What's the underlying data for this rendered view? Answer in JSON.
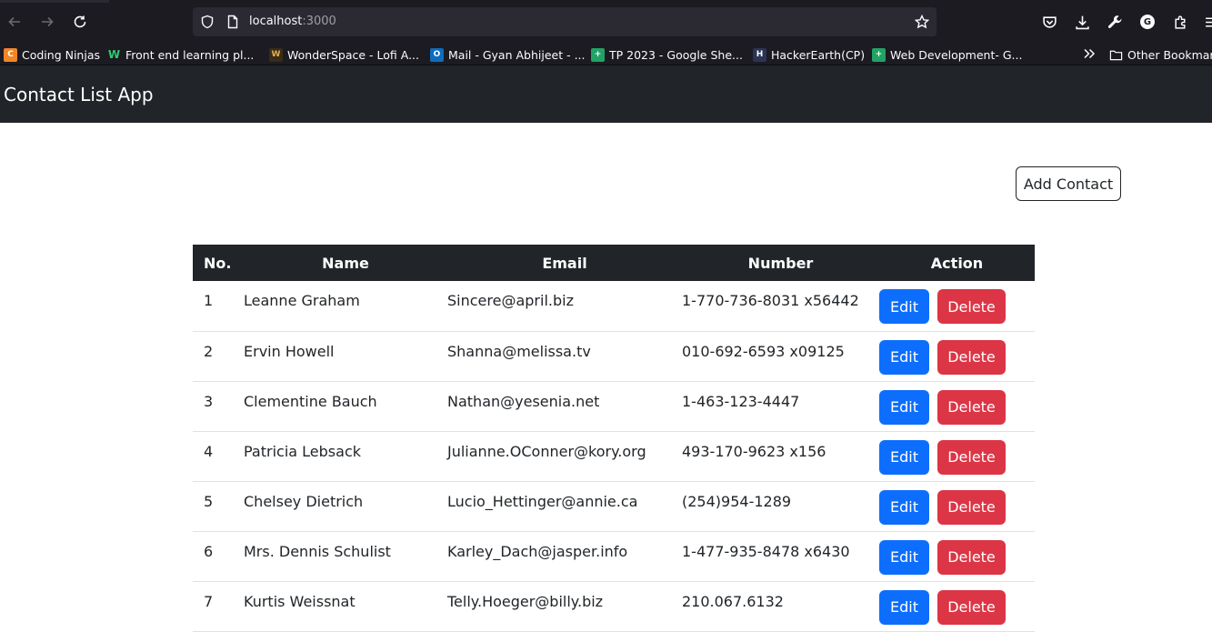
{
  "browser": {
    "url_host": "localhost",
    "url_port": ":3000",
    "profile_initial": "G",
    "bookmarks": [
      {
        "label": "Coding Ninjas",
        "fav_color": "#f28627",
        "fav_text": "C"
      },
      {
        "label": "Front end learning pl...",
        "fav_color": "#1c1b22",
        "fav_text": "W"
      },
      {
        "label": "WonderSpace - Lofi A...",
        "fav_color": "#3a2b1a",
        "fav_text": "W"
      },
      {
        "label": "Mail - Gyan Abhijeet - ...",
        "fav_color": "#0f6cbd",
        "fav_text": "O"
      },
      {
        "label": "TP 2023 - Google She...",
        "fav_color": "#21a366",
        "fav_text": "+"
      },
      {
        "label": "HackerEarth(CP)",
        "fav_color": "#2c3454",
        "fav_text": "H"
      },
      {
        "label": "Web Development- G...",
        "fav_color": "#21a366",
        "fav_text": "+"
      }
    ],
    "other_bookmarks": "Other Bookmarks"
  },
  "app": {
    "brand": "Contact List App",
    "add_button": "Add Contact",
    "table": {
      "headers": [
        "No.",
        "Name",
        "Email",
        "Number",
        "Action"
      ],
      "edit_label": "Edit",
      "delete_label": "Delete",
      "rows": [
        {
          "no": "1",
          "name": "Leanne Graham",
          "email": "Sincere@april.biz",
          "number": "1-770-736-8031 x56442"
        },
        {
          "no": "2",
          "name": "Ervin Howell",
          "email": "Shanna@melissa.tv",
          "number": "010-692-6593 x09125"
        },
        {
          "no": "3",
          "name": "Clementine Bauch",
          "email": "Nathan@yesenia.net",
          "number": "1-463-123-4447"
        },
        {
          "no": "4",
          "name": "Patricia Lebsack",
          "email": "Julianne.OConner@kory.org",
          "number": "493-170-9623 x156"
        },
        {
          "no": "5",
          "name": "Chelsey Dietrich",
          "email": "Lucio_Hettinger@annie.ca",
          "number": "(254)954-1289"
        },
        {
          "no": "6",
          "name": "Mrs. Dennis Schulist",
          "email": "Karley_Dach@jasper.info",
          "number": "1-477-935-8478 x6430"
        },
        {
          "no": "7",
          "name": "Kurtis Weissnat",
          "email": "Telly.Hoeger@billy.biz",
          "number": "210.067.6132"
        }
      ]
    }
  },
  "colors": {
    "navbar": "#212529",
    "edit": "#0d6efd",
    "delete": "#dc3545"
  }
}
